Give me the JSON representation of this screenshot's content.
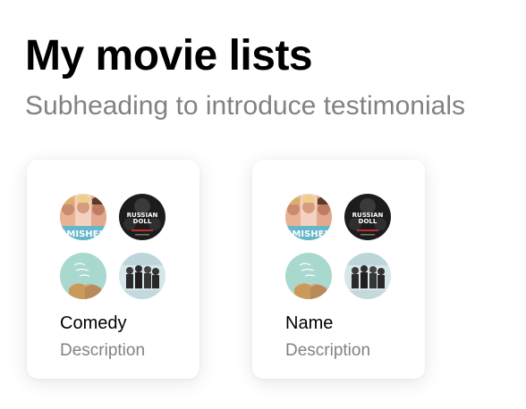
{
  "header": {
    "title": "My movie lists",
    "subtitle": "Subheading to introduce testimonials"
  },
  "lists": [
    {
      "title": "Comedy",
      "description": "Description",
      "posters": [
        "comedy-poster-image",
        "russian-doll-poster-image",
        "pastel-movie-poster-image",
        "group-movie-poster-image"
      ]
    },
    {
      "title": "Name",
      "description": "Description",
      "posters": [
        "comedy-poster-image",
        "russian-doll-poster-image",
        "pastel-movie-poster-image",
        "group-movie-poster-image"
      ]
    }
  ],
  "poster_art": {
    "p1": "SMISHED",
    "p2_line1": "RUSSIAN",
    "p2_line2": "DOLL"
  },
  "colors": {
    "title": "#000000",
    "subtitle": "#828282",
    "card_background": "#ffffff"
  }
}
